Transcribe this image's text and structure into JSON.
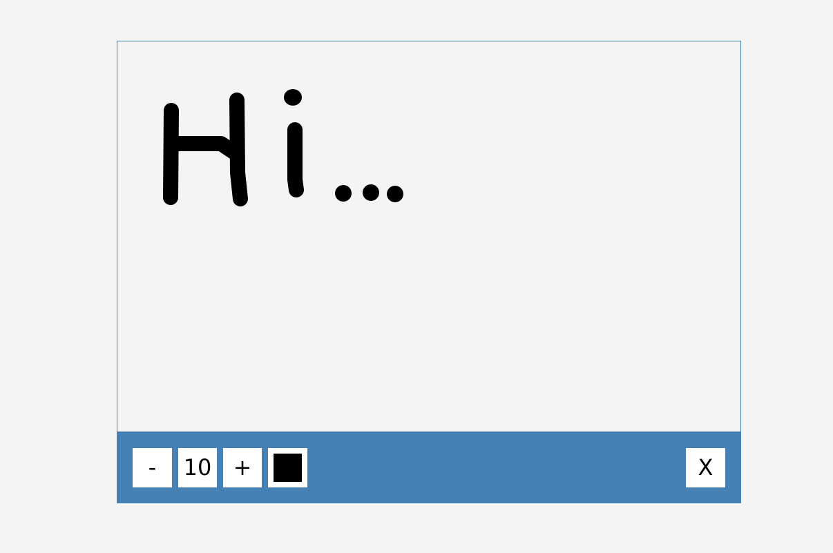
{
  "toolbar": {
    "decrease_label": "-",
    "brush_size": "10",
    "increase_label": "+",
    "color": "#000000",
    "close_label": "X"
  },
  "colors": {
    "toolbar_bg": "#4780b4",
    "frame_border": "#4780b4",
    "canvas_bg": "#f4f4f4",
    "ink": "#000000"
  },
  "drawing": {
    "handwritten_text": "Hi..."
  }
}
